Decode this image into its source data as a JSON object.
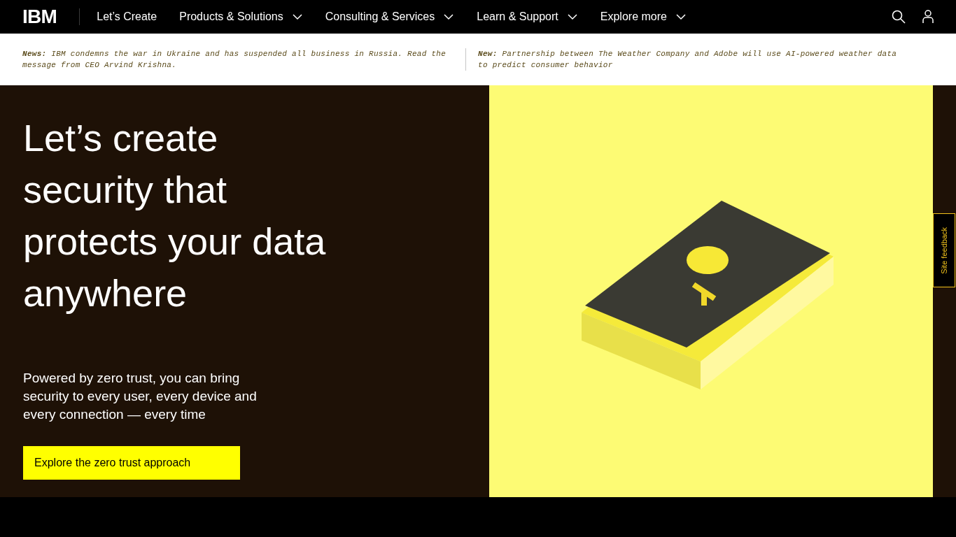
{
  "header": {
    "logo": "IBM",
    "nav": [
      {
        "label": "Let’s Create",
        "has_menu": false
      },
      {
        "label": "Products & Solutions",
        "has_menu": true
      },
      {
        "label": "Consulting & Services",
        "has_menu": true
      },
      {
        "label": "Learn & Support",
        "has_menu": true
      },
      {
        "label": "Explore more",
        "has_menu": true
      }
    ]
  },
  "news": [
    "**News:** IBM condemns the war in Ukraine and has suspended all business in Russia. Read the message from CEO Arvind Krishna.",
    "**New:** Partnership between The Weather Company and Adobe will use AI-powered weather data to predict consumer behavior"
  ],
  "hero": {
    "title": "Let’s create security that protects your data anywhere",
    "subtitle": "Powered by zero trust, you can bring security to every user, every device and every connection — every time",
    "cta": "Explore the zero trust approach"
  },
  "feedback_tab": "Site feedback"
}
